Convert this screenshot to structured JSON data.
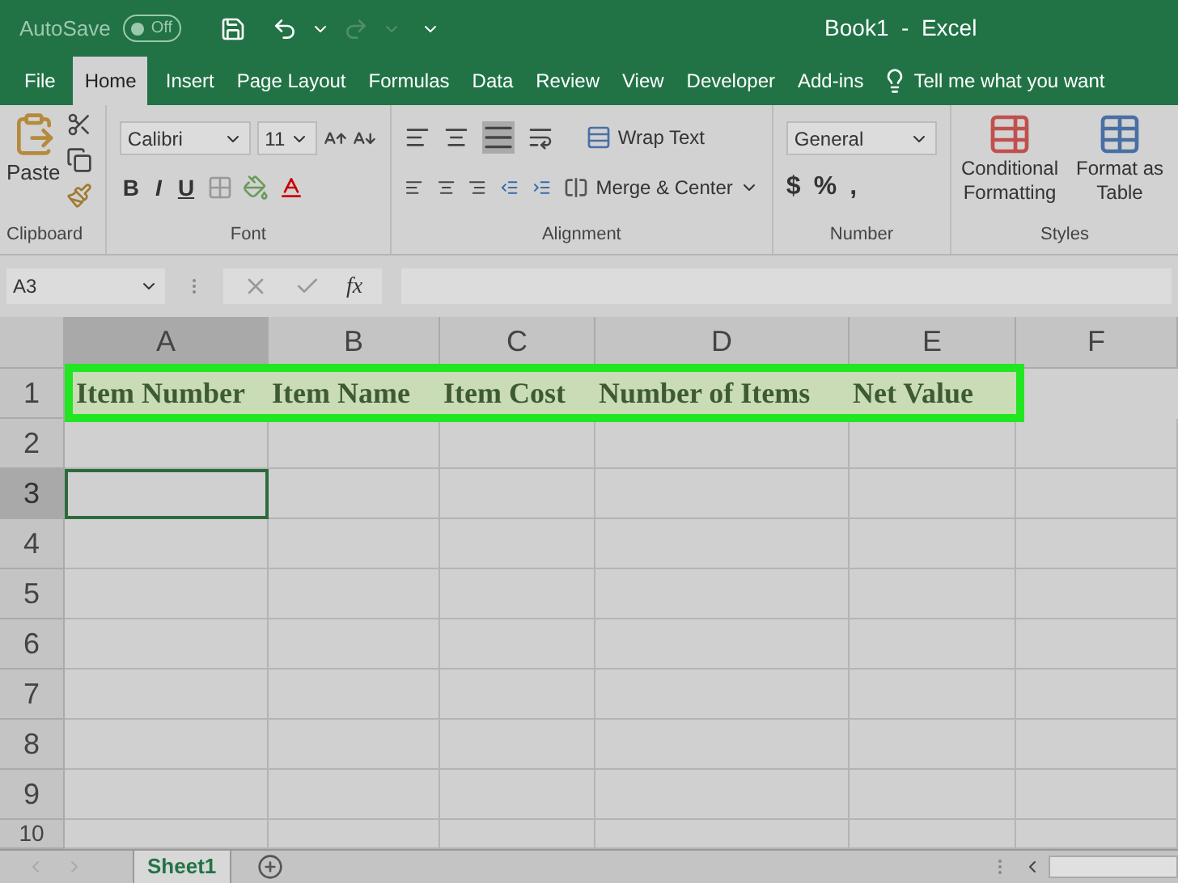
{
  "title_bar": {
    "autosave_label": "AutoSave",
    "autosave_toggle": {
      "label": "Off",
      "on": false
    },
    "title": "Book1  -  Excel"
  },
  "ribbon_tabs": [
    {
      "label": "File",
      "selected": false
    },
    {
      "label": "Home",
      "selected": true
    },
    {
      "label": "Insert",
      "selected": false
    },
    {
      "label": "Page Layout",
      "selected": false
    },
    {
      "label": "Formulas",
      "selected": false
    },
    {
      "label": "Data",
      "selected": false
    },
    {
      "label": "Review",
      "selected": false
    },
    {
      "label": "View",
      "selected": false
    },
    {
      "label": "Developer",
      "selected": false
    },
    {
      "label": "Add-ins",
      "selected": false
    }
  ],
  "tell_me": {
    "placeholder": "Tell me what you want"
  },
  "ribbon": {
    "clipboard": {
      "paste": "Paste",
      "label": "Clipboard"
    },
    "font": {
      "font_name": "Calibri",
      "font_size": "11",
      "styles": [
        "B",
        "I",
        "U"
      ],
      "label": "Font"
    },
    "alignment": {
      "wrap_text": "Wrap Text",
      "merge_center": "Merge & Center",
      "label": "Alignment"
    },
    "number": {
      "format": "General",
      "symbols": [
        "$",
        "%",
        ","
      ],
      "label": "Number"
    },
    "styles": {
      "buttons": [
        "Conditional Formatting",
        "Format as Table"
      ],
      "label": "Styles"
    }
  },
  "formula_bar": {
    "name_box": "A3",
    "fx": "fx"
  },
  "columns": [
    {
      "label": "A",
      "selected": true
    },
    {
      "label": "B",
      "selected": false
    },
    {
      "label": "C",
      "selected": false
    },
    {
      "label": "D",
      "selected": false
    },
    {
      "label": "E",
      "selected": false
    },
    {
      "label": "F",
      "selected": false
    }
  ],
  "rows": [
    {
      "label": "1",
      "selected": false,
      "highlighted": true,
      "cells": [
        "Item Number",
        "Item Name",
        "Item Cost",
        "Number of Items",
        "Net Value"
      ]
    },
    {
      "label": "2",
      "selected": false,
      "highlighted": false,
      "cells": []
    },
    {
      "label": "3",
      "selected": true,
      "highlighted": false,
      "cells": []
    },
    {
      "label": "4",
      "selected": false,
      "highlighted": false,
      "cells": []
    },
    {
      "label": "5",
      "selected": false,
      "highlighted": false,
      "cells": []
    },
    {
      "label": "6",
      "selected": false,
      "highlighted": false,
      "cells": []
    },
    {
      "label": "7",
      "selected": false,
      "highlighted": false,
      "cells": []
    },
    {
      "label": "8",
      "selected": false,
      "highlighted": false,
      "cells": []
    },
    {
      "label": "9",
      "selected": false,
      "highlighted": false,
      "cells": []
    },
    {
      "label": "10",
      "selected": false,
      "highlighted": false,
      "cells": []
    }
  ],
  "sheet_tabs": [
    {
      "label": "Sheet1",
      "selected": true
    }
  ]
}
